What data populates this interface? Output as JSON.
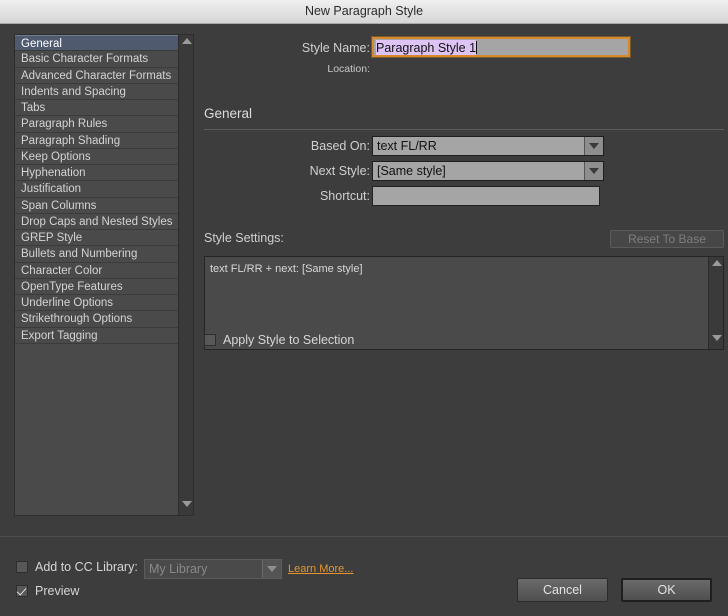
{
  "window": {
    "title": "New Paragraph Style"
  },
  "sidebar": {
    "items": [
      {
        "label": "General",
        "selected": true
      },
      {
        "label": "Basic Character Formats",
        "selected": false
      },
      {
        "label": "Advanced Character Formats",
        "selected": false
      },
      {
        "label": "Indents and Spacing",
        "selected": false
      },
      {
        "label": "Tabs",
        "selected": false
      },
      {
        "label": "Paragraph Rules",
        "selected": false
      },
      {
        "label": "Paragraph Shading",
        "selected": false
      },
      {
        "label": "Keep Options",
        "selected": false
      },
      {
        "label": "Hyphenation",
        "selected": false
      },
      {
        "label": "Justification",
        "selected": false
      },
      {
        "label": "Span Columns",
        "selected": false
      },
      {
        "label": "Drop Caps and Nested Styles",
        "selected": false
      },
      {
        "label": "GREP Style",
        "selected": false
      },
      {
        "label": "Bullets and Numbering",
        "selected": false
      },
      {
        "label": "Character Color",
        "selected": false
      },
      {
        "label": "OpenType Features",
        "selected": false
      },
      {
        "label": "Underline Options",
        "selected": false
      },
      {
        "label": "Strikethrough Options",
        "selected": false
      },
      {
        "label": "Export Tagging",
        "selected": false
      }
    ],
    "scroll_up_icon": "triangle-up-icon",
    "scroll_down_icon": "triangle-down-icon"
  },
  "form": {
    "style_name_label": "Style Name:",
    "style_name_value": "Paragraph Style 1",
    "location_label": "Location:",
    "location_value": "",
    "section_title": "General",
    "based_on_label": "Based On:",
    "based_on_value": "text FL/RR",
    "next_style_label": "Next Style:",
    "next_style_value": "[Same style]",
    "shortcut_label": "Shortcut:",
    "shortcut_value": "",
    "style_settings_label": "Style Settings:",
    "reset_to_base_label": "Reset To Base",
    "style_settings_text": "text FL/RR + next: [Same style]",
    "apply_style_label": "Apply Style to Selection",
    "apply_style_checked": false,
    "dropdown_icon": "chevron-down-icon"
  },
  "footer": {
    "cc_library_label": "Add to CC Library:",
    "cc_library_checked": false,
    "cc_library_value": "My Library",
    "learn_more_label": "Learn More...",
    "preview_label": "Preview",
    "preview_checked": true,
    "cancel_label": "Cancel",
    "ok_label": "OK"
  },
  "colors": {
    "dialog_bg": "#3d3d3d",
    "panel_bg": "#4a4a4a",
    "selection_blue": "#4f5a6e",
    "focus_orange": "#d6892e",
    "text_selection_purple": "#ddc4f5",
    "link_orange": "#e8942e",
    "input_bg": "#a5a5a5"
  }
}
